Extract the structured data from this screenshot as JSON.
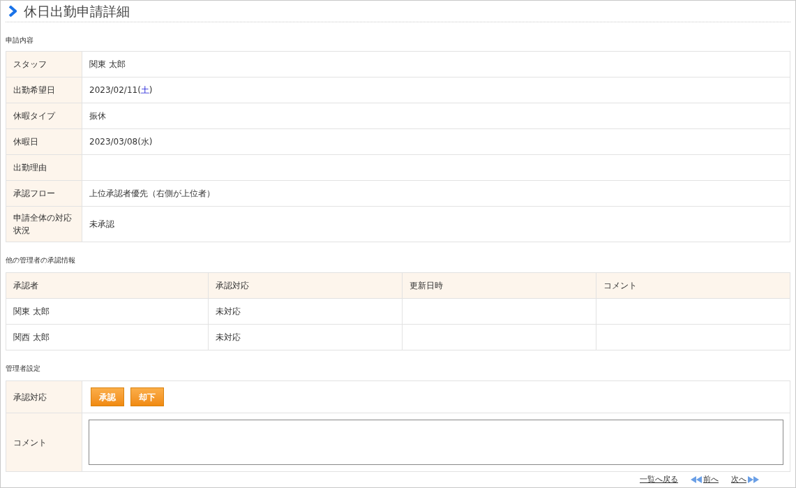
{
  "page_title": "休日出勤申請詳細",
  "request_section": {
    "heading": "申請内容",
    "rows": [
      {
        "label": "スタッフ",
        "value": "関東 太郎"
      },
      {
        "label": "出勤希望日",
        "value": "2023/02/11(",
        "weekday": {
          "text": "土",
          "kind": "saturday"
        },
        "suffix": ")"
      },
      {
        "label": "休暇タイプ",
        "value": "振休"
      },
      {
        "label": "休暇日",
        "value": "2023/03/08(",
        "weekday": {
          "text": "水",
          "kind": "weekday"
        },
        "suffix": ")"
      },
      {
        "label": "出勤理由"
      },
      {
        "label": "承認フロー",
        "value": "上位承認者優先（右側が上位者）"
      },
      {
        "label": "申請全体の対応状況",
        "value": "未承認"
      }
    ]
  },
  "approvals_section": {
    "heading": "他の管理者の承認情報",
    "columns": [
      "承認者",
      "承認対応",
      "更新日時",
      "コメント"
    ],
    "rows": [
      [
        "関東 太郎",
        "未対応"
      ],
      [
        "関西 太郎",
        "未対応"
      ]
    ]
  },
  "admin_section": {
    "heading": "管理者設定",
    "action_label": "承認対応",
    "buttons": [
      "承認",
      "却下"
    ],
    "comment_label": "コメント"
  },
  "footer_links": [
    {
      "label": "一覧へ戻る",
      "kind": "plain"
    },
    {
      "label": "前へ",
      "kind": "prev"
    },
    {
      "label": "次へ",
      "kind": "next"
    }
  ]
}
